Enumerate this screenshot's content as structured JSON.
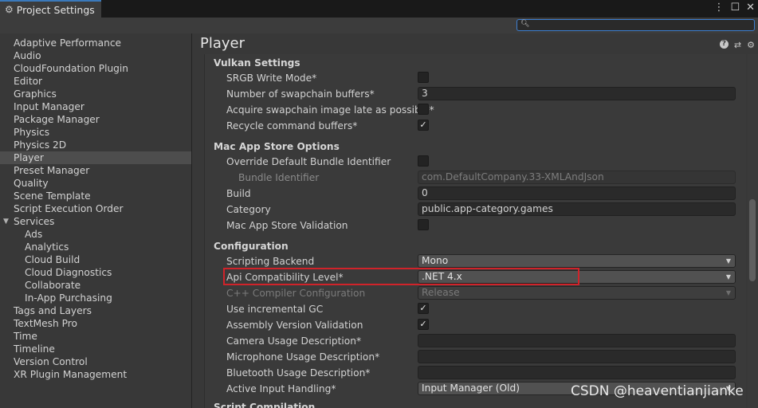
{
  "window": {
    "tab_title": "Project Settings",
    "controls": [
      "⋮",
      "☐",
      "✕"
    ]
  },
  "search": {
    "placeholder": "",
    "value": ""
  },
  "sidebar": {
    "items": [
      {
        "label": "Adaptive Performance",
        "level": 0
      },
      {
        "label": "Audio",
        "level": 0
      },
      {
        "label": "CloudFoundation Plugin",
        "level": 0
      },
      {
        "label": "Editor",
        "level": 0
      },
      {
        "label": "Graphics",
        "level": 0
      },
      {
        "label": "Input Manager",
        "level": 0
      },
      {
        "label": "Package Manager",
        "level": 0
      },
      {
        "label": "Physics",
        "level": 0
      },
      {
        "label": "Physics 2D",
        "level": 0
      },
      {
        "label": "Player",
        "level": 0,
        "selected": true
      },
      {
        "label": "Preset Manager",
        "level": 0
      },
      {
        "label": "Quality",
        "level": 0
      },
      {
        "label": "Scene Template",
        "level": 0
      },
      {
        "label": "Script Execution Order",
        "level": 0
      },
      {
        "label": "Services",
        "level": 0,
        "expanded": true
      },
      {
        "label": "Ads",
        "level": 1
      },
      {
        "label": "Analytics",
        "level": 1
      },
      {
        "label": "Cloud Build",
        "level": 1
      },
      {
        "label": "Cloud Diagnostics",
        "level": 1
      },
      {
        "label": "Collaborate",
        "level": 1
      },
      {
        "label": "In-App Purchasing",
        "level": 1
      },
      {
        "label": "Tags and Layers",
        "level": 0
      },
      {
        "label": "TextMesh Pro",
        "level": 0
      },
      {
        "label": "Time",
        "level": 0
      },
      {
        "label": "Timeline",
        "level": 0
      },
      {
        "label": "Version Control",
        "level": 0
      },
      {
        "label": "XR Plugin Management",
        "level": 0
      }
    ]
  },
  "main": {
    "title": "Player",
    "tool_icons": [
      "help-icon",
      "preset-icon",
      "settings-gear-icon"
    ],
    "vulkan": {
      "heading": "Vulkan Settings",
      "srgb_write_mode": {
        "label": "SRGB Write Mode*",
        "checked": false
      },
      "swapchain_buffers": {
        "label": "Number of swapchain buffers*",
        "value": "3"
      },
      "acquire_late": {
        "label": "Acquire swapchain image late as possible*",
        "checked": false
      },
      "recycle_buffers": {
        "label": "Recycle command buffers*",
        "checked": true
      }
    },
    "mac": {
      "heading": "Mac App Store Options",
      "override_bundle": {
        "label": "Override Default Bundle Identifier",
        "checked": false
      },
      "bundle_id": {
        "label": "Bundle Identifier",
        "value": "com.DefaultCompany.33-XMLAndJson"
      },
      "build": {
        "label": "Build",
        "value": "0"
      },
      "category": {
        "label": "Category",
        "value": "public.app-category.games"
      },
      "validation": {
        "label": "Mac App Store Validation",
        "checked": false
      }
    },
    "config": {
      "heading": "Configuration",
      "scripting_backend": {
        "label": "Scripting Backend",
        "value": "Mono"
      },
      "api_level": {
        "label": "Api Compatibility Level*",
        "value": ".NET 4.x"
      },
      "cpp_config": {
        "label": "C++ Compiler Configuration",
        "value": "Release"
      },
      "incremental_gc": {
        "label": "Use incremental GC",
        "checked": true
      },
      "assembly_validation": {
        "label": "Assembly Version Validation",
        "checked": true
      },
      "camera_usage": {
        "label": "Camera Usage Description*",
        "value": ""
      },
      "mic_usage": {
        "label": "Microphone Usage Description*",
        "value": ""
      },
      "bluetooth_usage": {
        "label": "Bluetooth Usage Description*",
        "value": ""
      },
      "input_handling": {
        "label": "Active Input Handling*",
        "value": "Input Manager (Old)"
      }
    },
    "next_section_partial": "Script Compilation"
  },
  "colors": {
    "highlight": "#d0232a",
    "accent": "#3a79bb",
    "selected_row": "#4d4d4d"
  },
  "watermark": "CSDN @heaventianjianke"
}
